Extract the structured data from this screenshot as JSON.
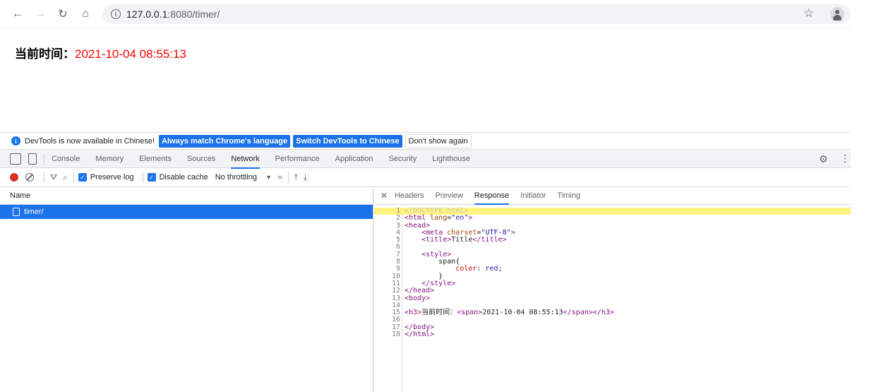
{
  "browser": {
    "url_host": "127.0.0.1",
    "url_path": ":8080/timer/"
  },
  "page": {
    "label": "当前时间：",
    "time": "2021-10-04 08:55:13"
  },
  "infobar": {
    "message": "DevTools is now available in Chinese!",
    "btn_match": "Always match Chrome's language",
    "btn_switch": "Switch DevTools to Chinese",
    "btn_dismiss": "Don't show again"
  },
  "devtools_tabs": [
    "Console",
    "Memory",
    "Elements",
    "Sources",
    "Network",
    "Performance",
    "Application",
    "Security",
    "Lighthouse"
  ],
  "network_toolbar": {
    "preserve_log": "Preserve log",
    "disable_cache": "Disable cache",
    "throttling": "No throttling"
  },
  "request_list": {
    "header": "Name",
    "items": [
      "timer/"
    ]
  },
  "detail_tabs": [
    "Headers",
    "Preview",
    "Response",
    "Initiator",
    "Timing"
  ],
  "response_lines": [
    "<!DOCTYPE html>",
    "<html lang=\"en\">",
    "<head>",
    "    <meta charset=\"UTF-8\">",
    "    <title>Title</title>",
    "",
    "    <style>",
    "        span{",
    "            color: red;",
    "        }",
    "    </style>",
    "</head>",
    "<body>",
    "",
    "<h3>当前时间：<span>2021-10-04 08:55:13</span></h3>",
    "",
    "</body>",
    "</html>"
  ]
}
